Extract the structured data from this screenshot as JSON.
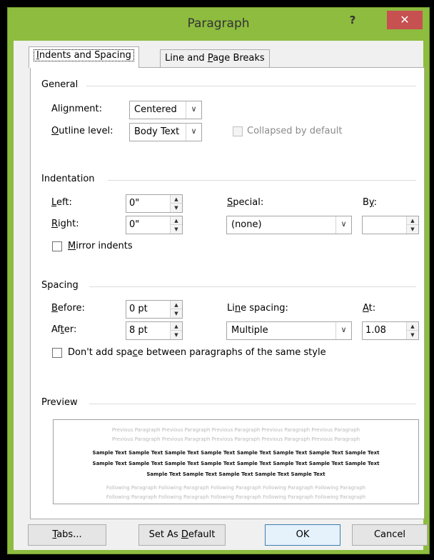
{
  "window": {
    "title": "Paragraph",
    "help_label": "?",
    "close_label": "✕"
  },
  "tabs": [
    {
      "label": "Indents and Spacing",
      "mnemonic": "I",
      "rest": "ndents and Spacing",
      "active": true
    },
    {
      "label": "Line and Page Breaks",
      "pre": "Line and ",
      "mnemonic": "P",
      "rest": "age Breaks",
      "active": false
    }
  ],
  "general": {
    "section_title": "General",
    "alignment_label_pre": "Ali",
    "alignment_label_mn": "g",
    "alignment_label_post": "nment:",
    "alignment_value": "Centered",
    "outline_label_mn": "O",
    "outline_label_post": "utline level:",
    "outline_value": "Body Text",
    "collapsed_label": "Collapsed by default"
  },
  "indentation": {
    "section_title": "Indentation",
    "left_mn": "L",
    "left_post": "eft:",
    "left_value": "0\"",
    "right_mn": "R",
    "right_post": "ight:",
    "right_value": "0\"",
    "special_mn": "S",
    "special_post": "pecial:",
    "special_value": "(none)",
    "by_pre": "B",
    "by_mn": "y",
    "by_post": ":",
    "by_value": "",
    "mirror_mn": "M",
    "mirror_post": "irror indents"
  },
  "spacing": {
    "section_title": "Spacing",
    "before_mn": "B",
    "before_post": "efore:",
    "before_value": "0 pt",
    "after_pre": "Af",
    "after_mn": "t",
    "after_post": "er:",
    "after_value": "8 pt",
    "line_spacing_pre": "Li",
    "line_spacing_mn": "n",
    "line_spacing_post": "e spacing:",
    "line_spacing_value": "Multiple",
    "at_mn": "A",
    "at_post": "t:",
    "at_value": "1.08",
    "dont_add_pre": "Don't add spa",
    "dont_add_mn": "c",
    "dont_add_post": "e between paragraphs of the same style"
  },
  "preview": {
    "section_title": "Preview",
    "prev_line_1": "Previous Paragraph Previous Paragraph Previous Paragraph Previous Paragraph Previous Paragraph",
    "prev_line_2": "Previous Paragraph Previous Paragraph Previous Paragraph Previous Paragraph Previous Paragraph",
    "sample_line_1": "Sample Text Sample Text Sample Text Sample Text Sample Text Sample Text Sample Text Sample Text",
    "sample_line_2": "Sample Text Sample Text Sample Text Sample Text Sample Text Sample Text Sample Text Sample Text",
    "sample_line_3": "Sample Text Sample Text Sample Text Sample Text Sample Text",
    "follow_line_1": "Following Paragraph Following Paragraph Following Paragraph Following Paragraph Following Paragraph",
    "follow_line_2": "Following Paragraph Following Paragraph Following Paragraph Following Paragraph Following Paragraph"
  },
  "buttons": {
    "tabs_mn": "T",
    "tabs_post": "abs...",
    "set_default_pre": "Set As ",
    "set_default_mn": "D",
    "set_default_post": "efault",
    "ok_label": "OK",
    "cancel_label": "Cancel"
  },
  "icons": {
    "dropdown": "chevron-down-icon",
    "spin_up": "spin-up-icon",
    "spin_down": "spin-down-icon"
  },
  "colors": {
    "frame_green": "#8dbc3f",
    "close_red": "#c75050",
    "default_button_border": "#3c7fb1"
  }
}
